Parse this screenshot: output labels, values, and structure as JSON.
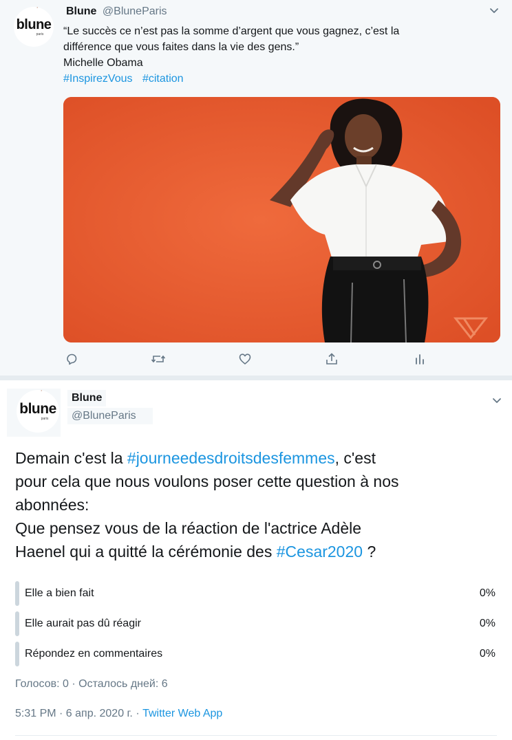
{
  "tweet1": {
    "avatar": {
      "brand": "blune",
      "sub": "paris"
    },
    "name": "Blune",
    "handle": "@BluneParis",
    "text_line1": "“Le succès ce n’est pas la somme d’argent que vous gagnez, c’est la",
    "text_line2": "différence que vous faites dans la vie des gens.”",
    "author": "Michelle Obama",
    "hashtags": [
      "#InspirezVous",
      "#citation"
    ],
    "media": {
      "background": "#e85a2f"
    },
    "actions": [
      "reply-icon",
      "retweet-icon",
      "like-icon",
      "share-icon",
      "analytics-icon"
    ]
  },
  "tweet2": {
    "avatar": {
      "brand": "blune",
      "sub": "paris"
    },
    "name": "Blune",
    "handle": "@BluneParis",
    "text": {
      "l1_pre": "Demain c'est la ",
      "l1_tag": "#journeedesdroitsdesfemmes",
      "l1_post": ", c'est",
      "l2": "pour cela que nous voulons poser cette question à nos",
      "l3": "abonnées:",
      "l4": "Que pensez vous de la réaction de l'actrice Adèle",
      "l5_pre": "Haenel qui a quitté la cérémonie des ",
      "l5_tag": "#Cesar2020",
      "l5_post": " ?"
    },
    "poll": {
      "options": [
        {
          "label": "Elle a bien fait",
          "percent": "0%"
        },
        {
          "label": "Elle aurait pas dû réagir",
          "percent": "0%"
        },
        {
          "label": "Répondez en commentaires",
          "percent": "0%"
        }
      ],
      "meta": "Голосов: 0 · Осталось дней: 6"
    },
    "time": "5:31 PM · 6 апр. 2020 г. · ",
    "source": "Twitter Web App"
  },
  "colors": {
    "link": "#1b95e0",
    "muted": "#657786",
    "text": "#14171a",
    "poll_bar": "#ccd6dd"
  }
}
